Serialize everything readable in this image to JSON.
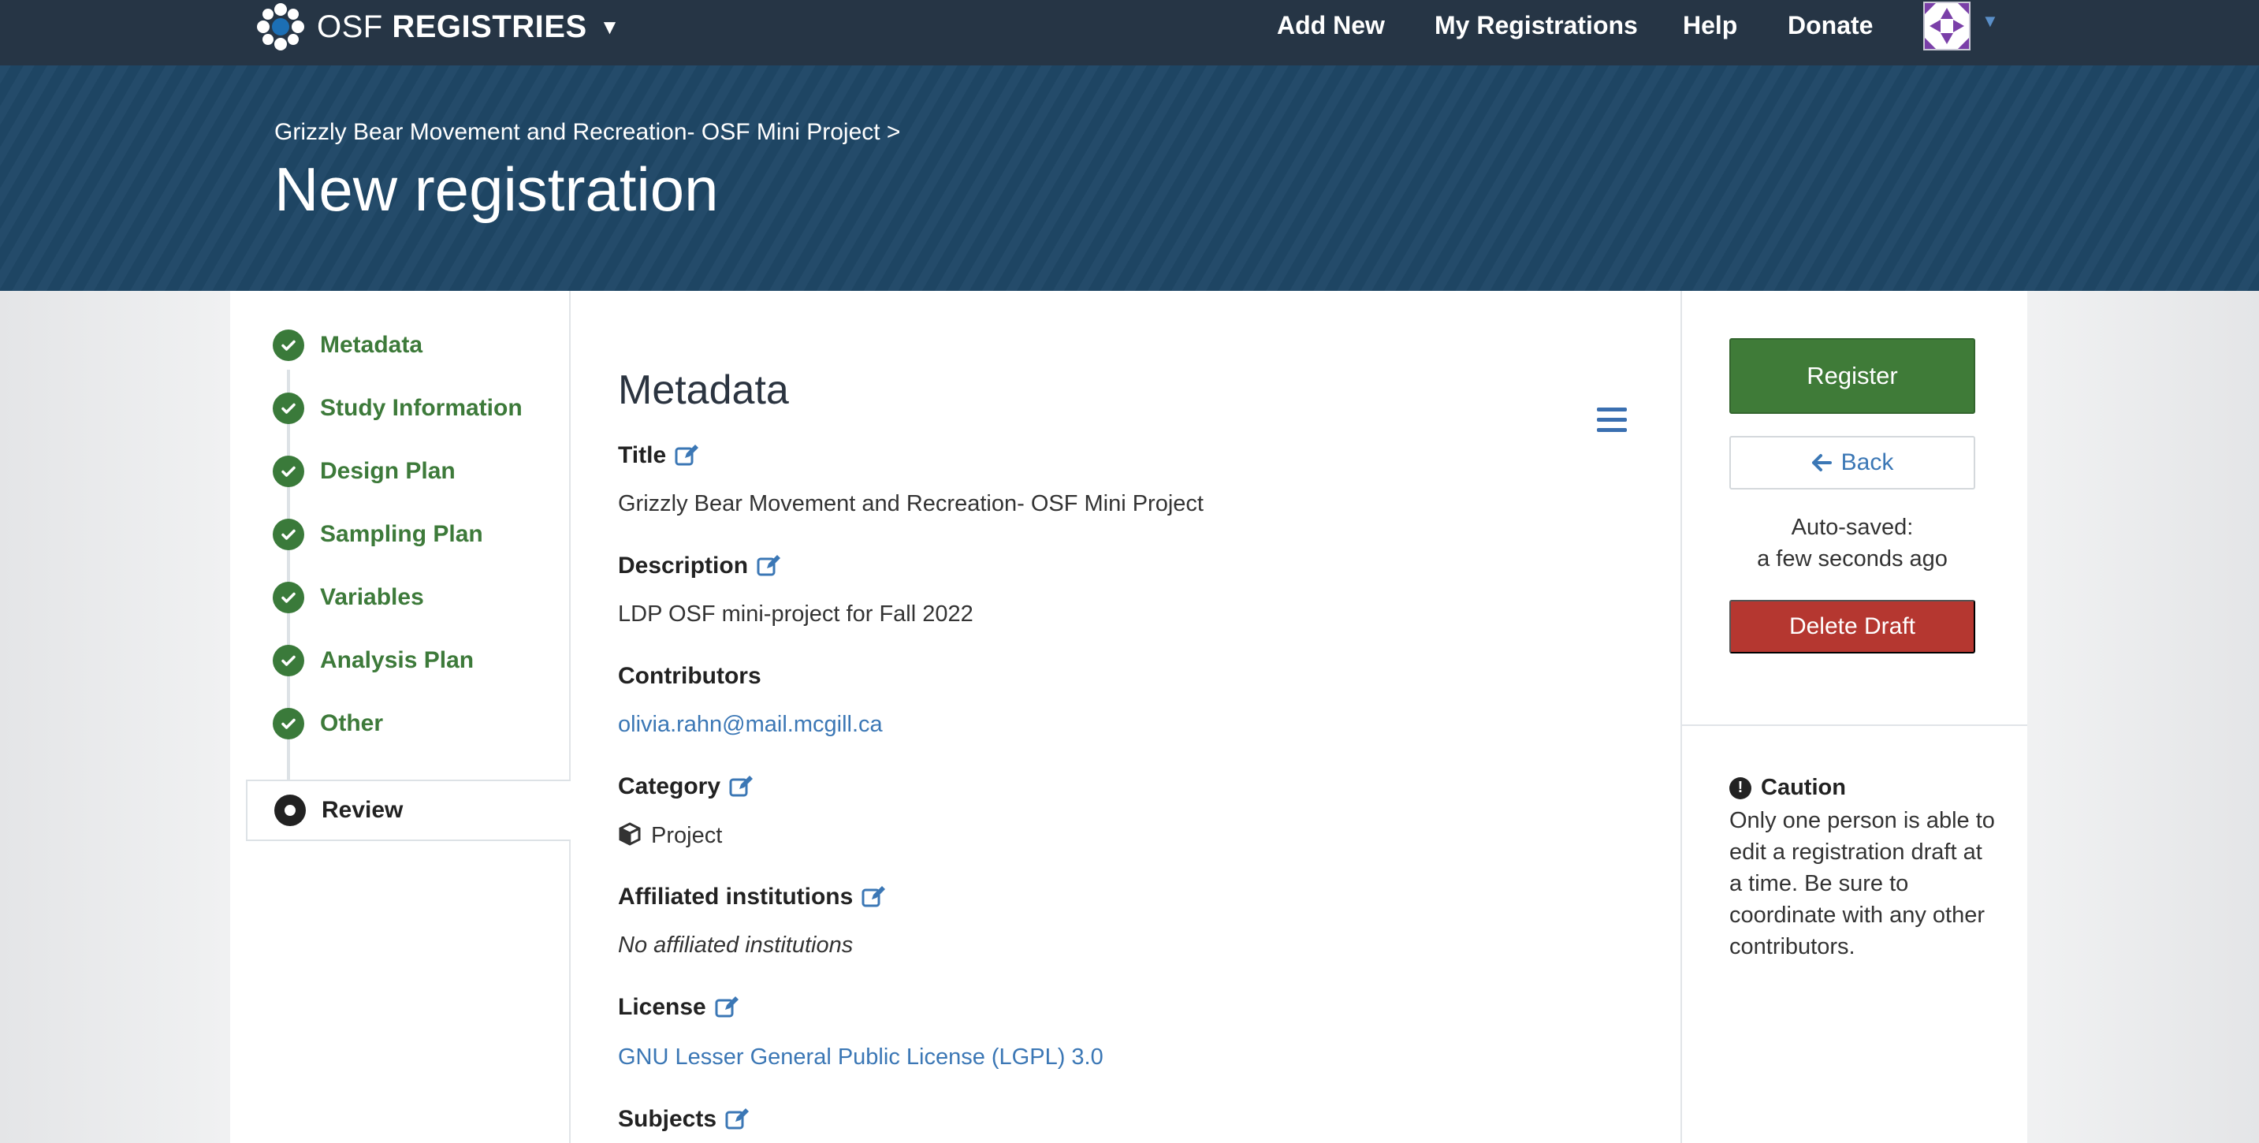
{
  "navbar": {
    "brand_prefix": "OSF",
    "brand_name": "REGISTRIES",
    "links": [
      "Add New",
      "My Registrations",
      "Help",
      "Donate"
    ]
  },
  "hero": {
    "breadcrumb": "Grizzly Bear Movement and Recreation- OSF Mini Project >",
    "title": "New registration"
  },
  "steps": [
    {
      "label": "Metadata",
      "state": "complete"
    },
    {
      "label": "Study Information",
      "state": "complete"
    },
    {
      "label": "Design Plan",
      "state": "complete"
    },
    {
      "label": "Sampling Plan",
      "state": "complete"
    },
    {
      "label": "Variables",
      "state": "complete"
    },
    {
      "label": "Analysis Plan",
      "state": "complete"
    },
    {
      "label": "Other",
      "state": "complete"
    },
    {
      "label": "Review",
      "state": "active"
    }
  ],
  "metadata": {
    "heading": "Metadata",
    "title_label": "Title",
    "title_value": "Grizzly Bear Movement and Recreation- OSF Mini Project",
    "description_label": "Description",
    "description_value": "LDP OSF mini-project for Fall 2022",
    "contributors_label": "Contributors",
    "contributors_value": "olivia.rahn@mail.mcgill.ca",
    "category_label": "Category",
    "category_value": "Project",
    "institutions_label": "Affiliated institutions",
    "institutions_value": "No affiliated institutions",
    "license_label": "License",
    "license_value": "GNU Lesser General Public License (LGPL) 3.0",
    "subjects_label": "Subjects"
  },
  "sidebar": {
    "register_label": "Register",
    "back_label": "Back",
    "autosave_line1": "Auto-saved:",
    "autosave_line2": "a few seconds ago",
    "delete_label": "Delete Draft",
    "caution_title": "Caution",
    "caution_text": "Only one person is able to edit a registration draft at a time. Be sure to coordinate with any other contributors."
  },
  "colors": {
    "navbar": "#263545",
    "hero": "#1f4766",
    "step_complete": "#3d7a3a",
    "register": "#3f7b38",
    "delete": "#b53730",
    "link": "#3b77b5"
  }
}
